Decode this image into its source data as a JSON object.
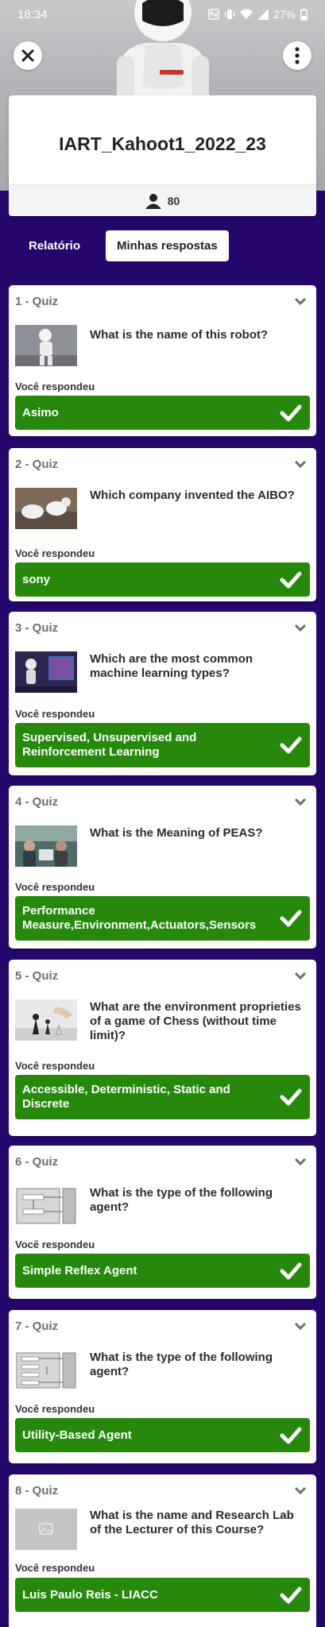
{
  "status_bar": {
    "time": "18:34",
    "battery": "27%"
  },
  "header": {
    "title": "IART_Kahoot1_2022_23",
    "players_count": "80"
  },
  "tabs": [
    {
      "label": "Relatório",
      "active": false
    },
    {
      "label": "Minhas respostas",
      "active": true
    }
  ],
  "answered_label": "Você respondeu",
  "colors": {
    "background": "#25076b",
    "correct": "#26890c"
  },
  "questions": [
    {
      "header": "1 - Quiz",
      "question": "What is the name of this robot?",
      "answer": "Asimo",
      "image": "robot-photo"
    },
    {
      "header": "2 - Quiz",
      "question": "Which company invented the AIBO?",
      "answer": "sony",
      "image": "robot-dog-photo"
    },
    {
      "header": "3 - Quiz",
      "question": "Which are the most common machine learning types?",
      "answer": "Supervised, Unsupervised and Reinforcement Learning",
      "image": "robot-screen-photo"
    },
    {
      "header": "4 - Quiz",
      "question": "What is the Meaning of PEAS?",
      "answer": "Performance Measure,Environment,Actuators,Sensors",
      "image": "people-photo"
    },
    {
      "header": "5 - Quiz",
      "question": "What are the environment proprieties of a game of Chess (without time limit)?",
      "answer": "Accessible, Deterministic, Static and Discrete",
      "image": "chess-photo"
    },
    {
      "header": "6 - Quiz",
      "question": "What is the type of the following agent?",
      "answer": "Simple Reflex Agent",
      "image": "agent-diagram"
    },
    {
      "header": "7 - Quiz",
      "question": "What is the type of the following agent?",
      "answer": "Utility-Based Agent",
      "image": "agent-diagram"
    },
    {
      "header": "8 - Quiz",
      "question": "What is the name and Research Lab of the Lecturer of this Course?",
      "answer": "Luis Paulo Reis - LIACC",
      "image": "image-placeholder"
    }
  ]
}
